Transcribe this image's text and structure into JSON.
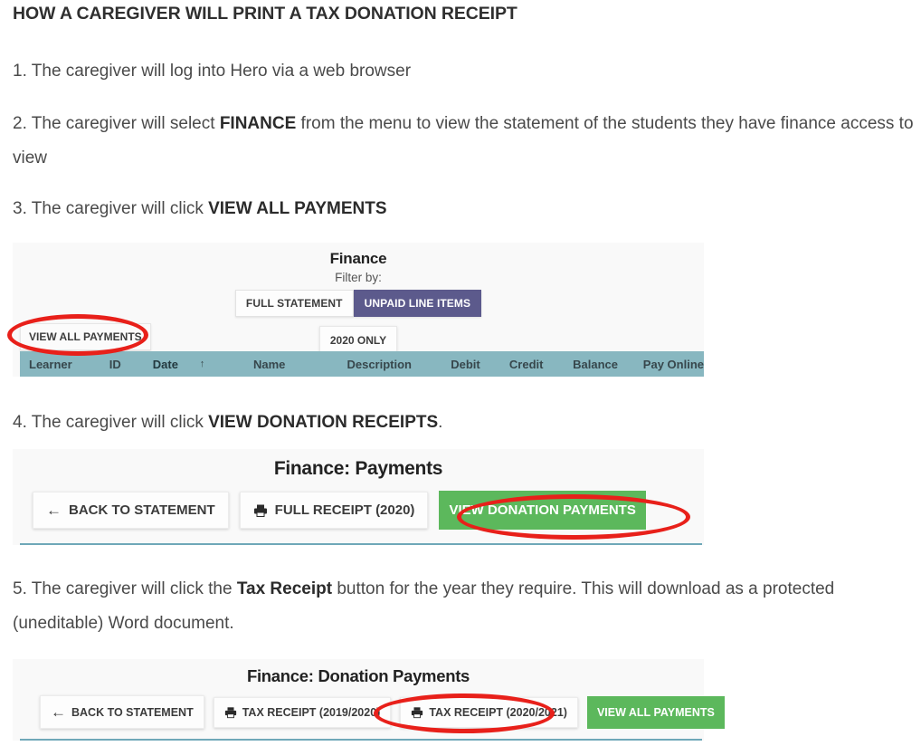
{
  "document": {
    "title": "HOW A CAREGIVER WILL PRINT A TAX DONATION RECEIPT",
    "steps": {
      "step1": "1. The caregiver will log into Hero via a web browser",
      "step2_a": "2. The caregiver will select ",
      "step2_bold": "FINANCE",
      "step2_b": " from the menu to view the statement of the students they have finance access to view",
      "step3_a": "3. The caregiver will click ",
      "step3_bold": "VIEW ALL PAYMENTS",
      "step4_a": "4.  The caregiver will click ",
      "step4_bold": "VIEW DONATION RECEIPTS",
      "step4_b": ".",
      "step5_a": "5.  The caregiver will click the ",
      "step5_bold": "Tax Receipt",
      "step5_b": " button for the year they require. This will download as a protected (uneditable) Word document."
    }
  },
  "finance_panel": {
    "title": "Finance",
    "filter_label": "Filter by:",
    "filter_full_statement": "FULL STATEMENT",
    "filter_unpaid_line_items": "UNPAID LINE ITEMS",
    "year_filter": "2020 ONLY",
    "view_all_payments": "VIEW ALL PAYMENTS",
    "table_headers": [
      "Learner",
      "ID",
      "Date",
      "Name",
      "Description",
      "Debit",
      "Credit",
      "Balance",
      "Pay Online"
    ],
    "sort_indicator": "↑",
    "colors": {
      "active_filter": "#5c5a8c",
      "table_header": "#88b7c0",
      "panel_background": "#f9f9f9"
    }
  },
  "payments_panel": {
    "title": "Finance: Payments",
    "back_button": "BACK TO STATEMENT",
    "full_receipt_button": "FULL RECEIPT (2020)",
    "view_donation_button": "VIEW DONATION PAYMENTS",
    "back_arrow": "←",
    "colors": {
      "primary_button": "#5cb85c"
    }
  },
  "donation_panel": {
    "title": "Finance: Donation Payments",
    "back_button": "BACK TO STATEMENT",
    "tax_receipt_2019": "TAX RECEIPT (2019/2020)",
    "tax_receipt_2020": "TAX RECEIPT (2020/2021)",
    "view_all_payments_button": "VIEW ALL PAYMENTS",
    "back_arrow": "←",
    "colors": {
      "primary_button": "#5cb85c"
    }
  },
  "annotations": {
    "highlight_color": "#e8201a",
    "circled": [
      "VIEW ALL PAYMENTS",
      "VIEW DONATION PAYMENTS",
      "TAX RECEIPT (2020/2021)"
    ]
  }
}
